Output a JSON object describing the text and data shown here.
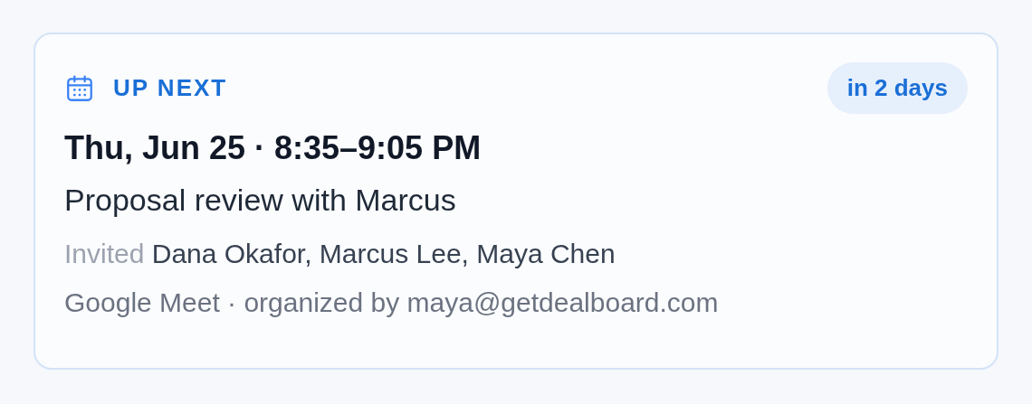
{
  "card": {
    "label": "UP NEXT",
    "badge": "in 2 days",
    "when": "Thu, Jun 25 · 8:35–9:05 PM",
    "title": "Proposal review with Marcus",
    "invited_label": "Invited",
    "invitees": "Dana Okafor, Marcus Lee, Maya Chen",
    "details": "Google Meet · organized by maya@getdealboard.com"
  }
}
